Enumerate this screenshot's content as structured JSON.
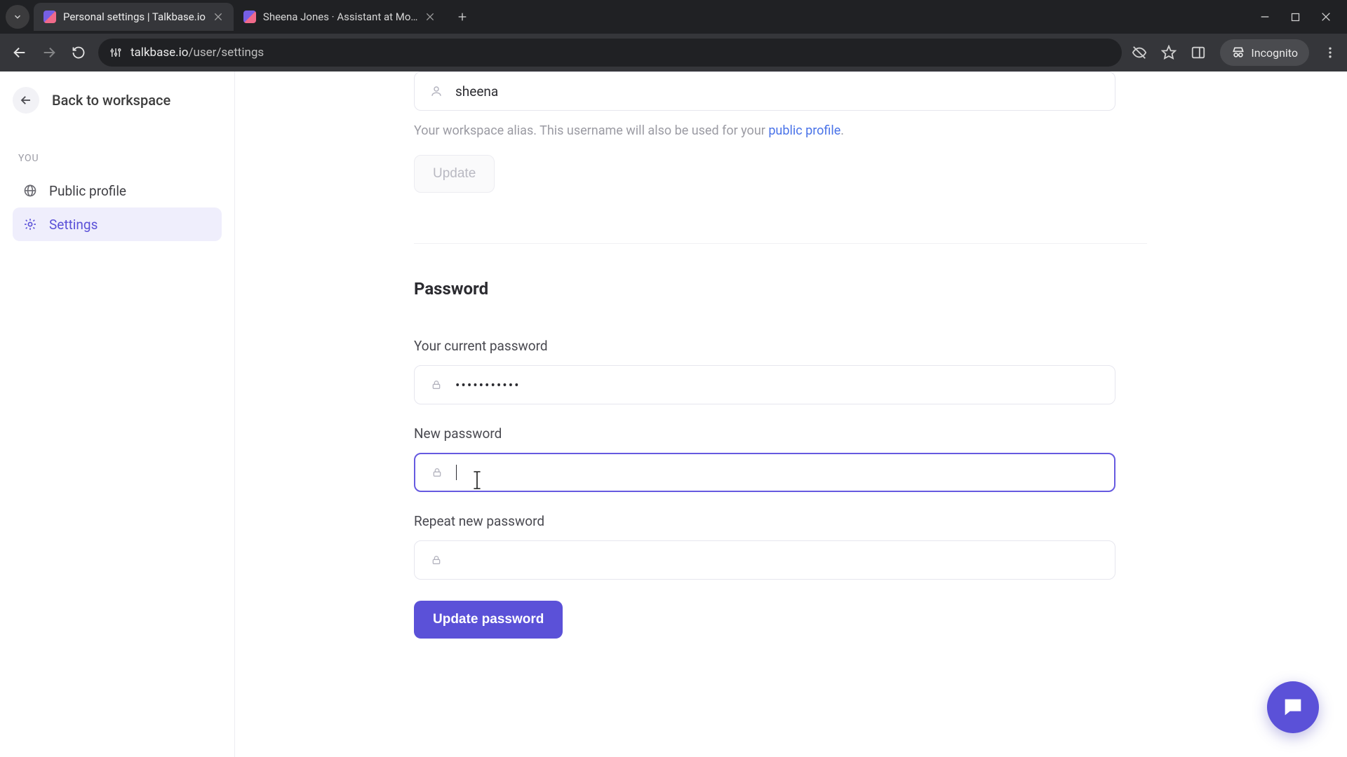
{
  "browser": {
    "tabs": [
      {
        "title": "Personal settings | Talkbase.io",
        "active": true
      },
      {
        "title": "Sheena Jones · Assistant at Mo…",
        "active": false
      }
    ],
    "url_host": "talkbase.io",
    "url_path": "/user/settings",
    "incognito_label": "Incognito"
  },
  "sidebar": {
    "back_label": "Back to workspace",
    "section": "YOU",
    "items": [
      {
        "label": "Public profile",
        "active": false
      },
      {
        "label": "Settings",
        "active": true
      }
    ]
  },
  "alias": {
    "value": "sheena",
    "help_prefix": "Your workspace alias. This username will also be used for your ",
    "help_link": "public profile",
    "help_suffix": ".",
    "update_label": "Update"
  },
  "password": {
    "heading": "Password",
    "current_label": "Your current password",
    "current_value": "•••••••••••",
    "new_label": "New password",
    "new_value": "",
    "repeat_label": "Repeat new password",
    "repeat_value": "",
    "submit_label": "Update password"
  }
}
